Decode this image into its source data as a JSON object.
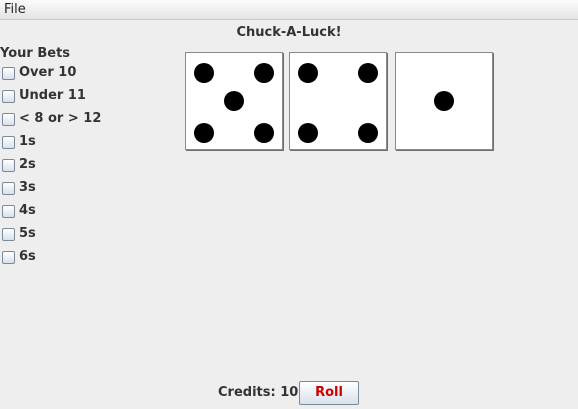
{
  "menu": {
    "file_label": "File"
  },
  "title": "Chuck-A-Luck!",
  "bets": {
    "heading": "Your Bets",
    "options": [
      {
        "label": "Over 10",
        "checked": false
      },
      {
        "label": "Under 11",
        "checked": false
      },
      {
        "label": "< 8 or > 12",
        "checked": false
      },
      {
        "label": "1s",
        "checked": false
      },
      {
        "label": "2s",
        "checked": false
      },
      {
        "label": "3s",
        "checked": false
      },
      {
        "label": "4s",
        "checked": false
      },
      {
        "label": "5s",
        "checked": false
      },
      {
        "label": "6s",
        "checked": false
      }
    ]
  },
  "dice": [
    5,
    4,
    1
  ],
  "footer": {
    "credits_label": "Credits: 10",
    "roll_label": "Roll",
    "roll_color": "#cc0000"
  }
}
